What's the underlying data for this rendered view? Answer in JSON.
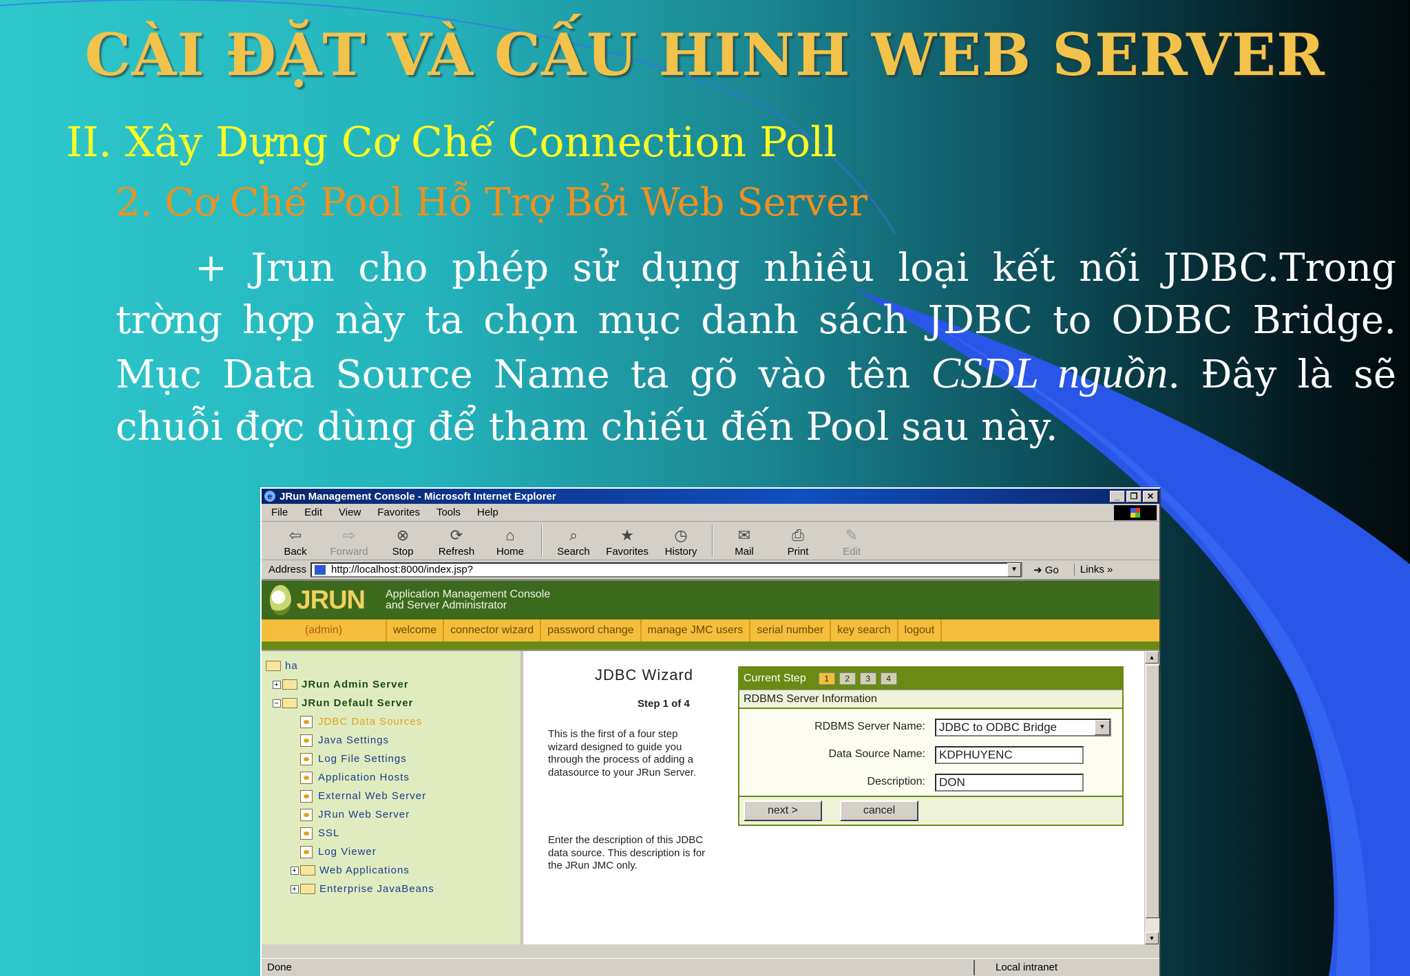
{
  "slide": {
    "title": "CÀI ĐẶT VÀ CẤU HINH WEB SERVER",
    "heading1": "II. Xây Dựng Cơ Chế Connection Poll",
    "heading2": "2. Cơ Chế Pool Hỗ Trợ Bởi Web Server",
    "paragraph": {
      "part1": "+ Jrun cho phép sử dụng nhiều loại kết nối JDBC.Trong trờng hợp này ta chọn mục danh sách JDBC to ODBC Bridge. Mục Data Source Name ta gõ vào tên ",
      "emphasis": "CSDL nguồn",
      "part2": ". Đây là sẽ chuỗi đợc dùng để tham chiếu đến Pool sau này."
    }
  },
  "browser": {
    "window_title": "JRun Management Console - Microsoft Internet Explorer",
    "menu": [
      "File",
      "Edit",
      "View",
      "Favorites",
      "Tools",
      "Help"
    ],
    "toolbar": {
      "back": "Back",
      "forward": "Forward",
      "stop": "Stop",
      "refresh": "Refresh",
      "home": "Home",
      "search": "Search",
      "favorites": "Favorites",
      "history": "History",
      "mail": "Mail",
      "print": "Print",
      "edit": "Edit"
    },
    "address_label": "Address",
    "url": "http://localhost:8000/index.jsp?",
    "go_label": "Go",
    "links_label": "Links",
    "status_text": "Done",
    "zone_text": "Local intranet"
  },
  "jrun": {
    "logo_text": "JRUN",
    "subtitle_line1": "Application Management Console",
    "subtitle_line2": "and Server Administrator",
    "nav": {
      "admin": "(admin)",
      "items": [
        "welcome",
        "connector wizard",
        "password change",
        "manage JMC users",
        "serial number",
        "key search",
        "logout"
      ]
    },
    "tree": {
      "root": "ha",
      "admin_server": "JRun Admin Server",
      "default_server": "JRun Default Server",
      "children": [
        "JDBC Data Sources",
        "Java Settings",
        "Log File Settings",
        "Application Hosts",
        "External Web Server",
        "JRun Web Server",
        "SSL",
        "Log Viewer"
      ],
      "web_apps": "Web Applications",
      "ejb": "Enterprise JavaBeans"
    },
    "wizard": {
      "heading": "JDBC Wizard",
      "step": "Step 1 of 4",
      "intro": "This is the first of a four step wizard designed to guide you through the process of adding a datasource to your JRun Server.",
      "description_help": "Enter the description of this JDBC data source. This description is for the JRun JMC only.",
      "current_step_label": "Current Step",
      "steps": [
        "1",
        "2",
        "3",
        "4"
      ],
      "section_title": "RDBMS Server Information",
      "rdbms_label": "RDBMS Server Name:",
      "rdbms_value": "JDBC to ODBC Bridge",
      "dsn_label": "Data Source Name:",
      "dsn_value": "KDPHUYENC",
      "desc_label": "Description:",
      "desc_value": "DON",
      "next_label": "next >",
      "cancel_label": "cancel"
    }
  }
}
